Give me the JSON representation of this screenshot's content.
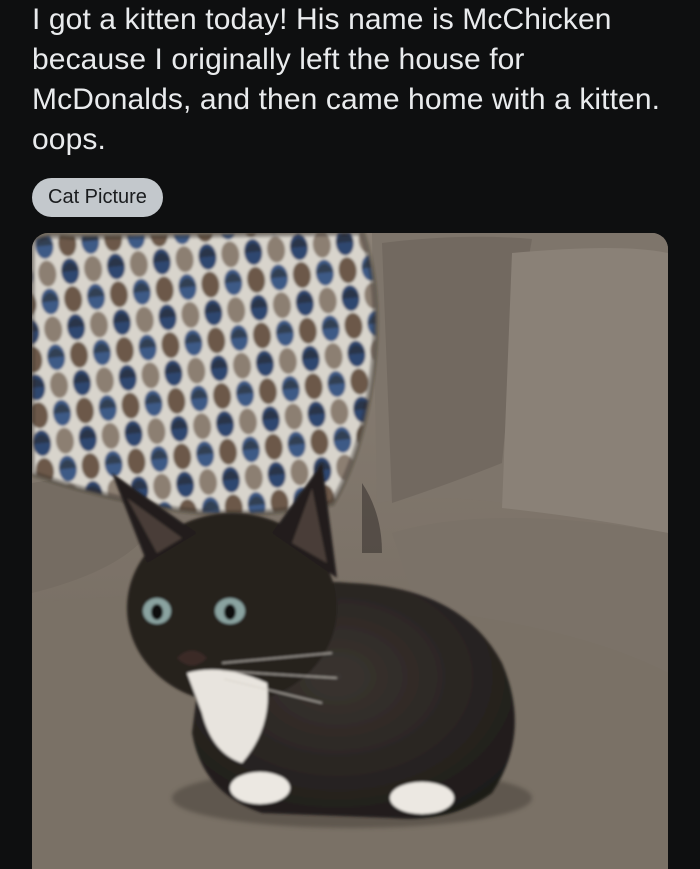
{
  "post": {
    "title": "I got a kitten today! His name is McChicken because I originally left the house for McDonalds, and then came home with a kitten. oops.",
    "flair": "Cat Picture"
  },
  "image": {
    "subject": "black-and-white-kitten",
    "colors": {
      "background": "#0e0f10",
      "text": "#e9ebed",
      "flair_bg": "#c3c8cc",
      "couch": "#857b70",
      "kitten_fur": "#2a2522"
    }
  }
}
